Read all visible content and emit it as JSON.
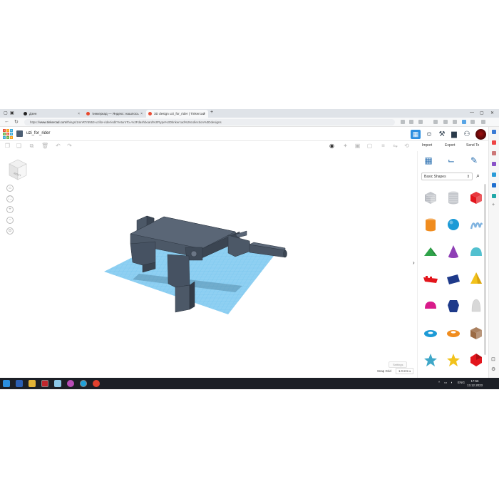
{
  "browser": {
    "tabs": [
      {
        "label": "Дзен",
        "active": false
      },
      {
        "label": "тинкеркад — Яндекс: нашлось",
        "active": false
      },
      {
        "label": "3D design uzi_for_rider | Tinkercad",
        "active": true
      }
    ],
    "new_tab": "+",
    "url_prefix": "https://",
    "url_host": "www.tinkercad.com",
    "url_path": "/things/1mnR7r5553-uzifor-rider/edit?returnTo=%2Fdashboard%3Ftype%3Dtinkercad%26collection%3Ddesigns"
  },
  "app": {
    "logo_letters": [
      "TIN",
      "KER",
      "CAD"
    ],
    "design_title": "uzi_for_rider",
    "actions": {
      "import": "Import",
      "export": "Export",
      "send_to": "Send To"
    }
  },
  "viewcube": {
    "face_label": "RIGHT"
  },
  "nav_controls": [
    "⌂",
    "⛶",
    "+",
    "−",
    "⊙"
  ],
  "workplane": {
    "settings_label": "Settings",
    "snap_label": "Snap Grid",
    "snap_value": "1.0 mm"
  },
  "panel": {
    "category": "Basic Shapes",
    "shapes": [
      {
        "name": "box-striped",
        "color": "#b9bcc2"
      },
      {
        "name": "cylinder-striped",
        "color": "#c4c7cc"
      },
      {
        "name": "box",
        "color": "#e3151c"
      },
      {
        "name": "cylinder",
        "color": "#f08c1e"
      },
      {
        "name": "sphere",
        "color": "#1c9ad6"
      },
      {
        "name": "scribble",
        "color": "#7fb3e0"
      },
      {
        "name": "roof",
        "color": "#2fa34a"
      },
      {
        "name": "cone",
        "color": "#8e3fb5"
      },
      {
        "name": "round-roof",
        "color": "#52c0cf"
      },
      {
        "name": "text",
        "color": "#e3151c"
      },
      {
        "name": "wedge",
        "color": "#1e3a8a"
      },
      {
        "name": "pyramid",
        "color": "#f2c21b"
      },
      {
        "name": "half-sphere",
        "color": "#d81b8a"
      },
      {
        "name": "polygon",
        "color": "#1e3a8a"
      },
      {
        "name": "paraboloid",
        "color": "#d8d8d8"
      },
      {
        "name": "torus",
        "color": "#1c9ad6"
      },
      {
        "name": "tube",
        "color": "#f08c1e"
      },
      {
        "name": "shape-generator",
        "color": "#9b6a43"
      },
      {
        "name": "star",
        "color": "#3fa7c8"
      },
      {
        "name": "star-yellow",
        "color": "#f2c21b"
      },
      {
        "name": "icosahedron",
        "color": "#e3151c"
      }
    ]
  },
  "taskbar": {
    "lang": "ENG",
    "time": "17:56",
    "date": "13.12.2023"
  }
}
